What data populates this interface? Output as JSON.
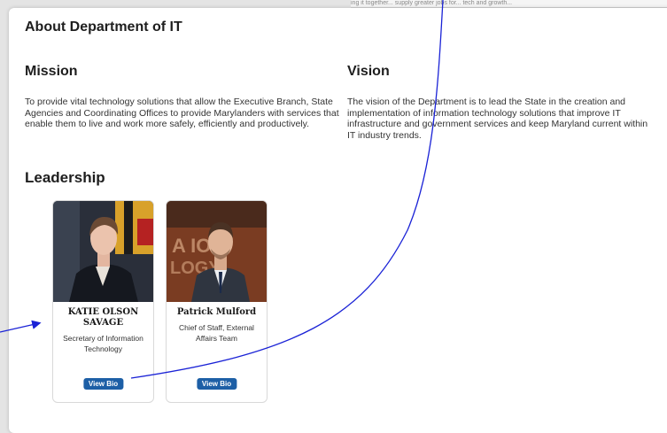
{
  "top_strip_text": "ing it together... supply greater jobs for... tech and growth...",
  "page": {
    "title": "About Department of IT"
  },
  "mission": {
    "heading": "Mission",
    "text": "To provide vital technology solutions that allow the Executive Branch, State Agencies and Coordinating Offices to provide Marylanders with services that enable them to live and work more safely, efficiently and productively."
  },
  "vision": {
    "heading": "Vision",
    "text": "The vision of the Department is to lead the State in the creation and implementation of information technology solutions that improve IT infrastructure and government services and keep Maryland current within IT industry trends."
  },
  "leadership": {
    "heading": "Leadership",
    "people": [
      {
        "name": "KATIE OLSON SAVAGE",
        "title": "Secretary of Information Technology",
        "button": "View Bio"
      },
      {
        "name": "Patrick Mulford",
        "title": "Chief of Staff, External Affairs Team",
        "button": "View Bio"
      }
    ]
  },
  "colors": {
    "button_blue": "#1d5fa6",
    "annotation_blue": "#1a22d6"
  }
}
